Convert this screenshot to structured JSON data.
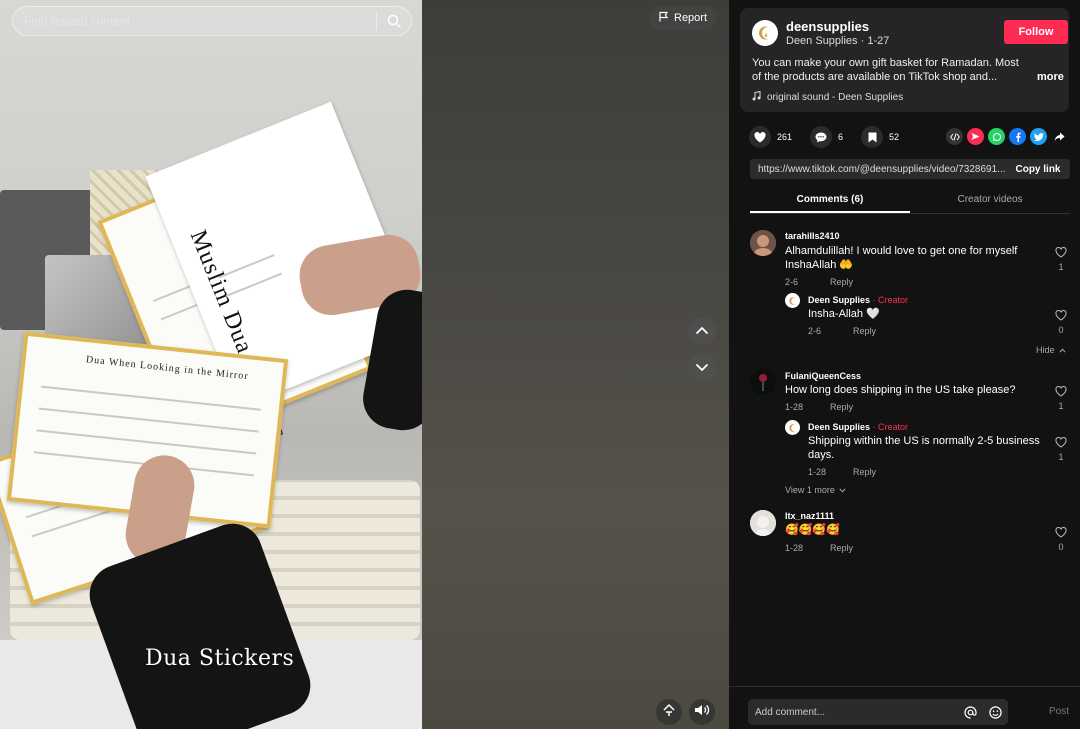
{
  "search": {
    "placeholder": "Find related content"
  },
  "video": {
    "report_label": "Report",
    "overlay_text": "Dua Stickers",
    "card_title": "Muslim Dua Stickers",
    "mirror_card_title": "Dua When Looking in the Mirror"
  },
  "post": {
    "username": "deensupplies",
    "display_name": "Deen  Supplies",
    "date": "1-27",
    "follow_label": "Follow",
    "description": "You can make your own gift basket for Ramadan. Most of the products are available on TikTok shop and...",
    "more_label": "more",
    "sound": "original sound - Deen  Supplies"
  },
  "actions": {
    "likes": "261",
    "comments": "6",
    "saves": "52"
  },
  "share_icons": [
    "embed-icon",
    "send-icon",
    "whatsapp-icon",
    "facebook-icon",
    "twitter-icon",
    "share-arrow-icon"
  ],
  "link": {
    "url": "https://www.tiktok.com/@deensupplies/video/7328691...",
    "copy_label": "Copy link"
  },
  "tabs": [
    {
      "label": "Comments (6)",
      "active": true
    },
    {
      "label": "Creator videos",
      "active": false
    }
  ],
  "comments": [
    {
      "user": "tarahills2410",
      "text": "Alhamdulillah! I would love to get one for myself InshaAllah 🤲",
      "date": "2-6",
      "reply_label": "Reply",
      "likes": "1",
      "replies": [
        {
          "user": "Deen  Supplies",
          "badge": "· Creator",
          "text": "Insha-Allah 🤍",
          "date": "2-6",
          "reply_label": "Reply",
          "likes": "0"
        }
      ],
      "toggle_label": "Hide"
    },
    {
      "user": "FulaniQueenCess",
      "text": "How long does shipping in the US take please?",
      "date": "1-28",
      "reply_label": "Reply",
      "likes": "1",
      "replies": [
        {
          "user": "Deen  Supplies",
          "badge": "· Creator",
          "text": "Shipping within the US is normally 2-5 business days.",
          "date": "1-28",
          "reply_label": "Reply",
          "likes": "1"
        }
      ],
      "toggle_label": "View 1 more"
    },
    {
      "user": "ltx_naz1111",
      "text": "🥰🥰🥰🥰",
      "date": "1-28",
      "reply_label": "Reply",
      "likes": "0"
    }
  ],
  "composer": {
    "placeholder": "Add comment...",
    "post_label": "Post"
  },
  "colors": {
    "accent": "#fe2c55",
    "panel_bg": "#121212",
    "card_bg": "#252525"
  }
}
